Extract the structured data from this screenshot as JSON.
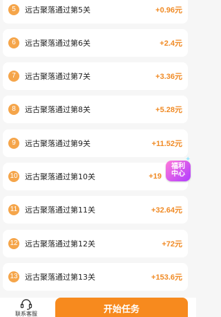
{
  "levels": [
    {
      "num": "5",
      "label": "远古聚落通过第5关",
      "reward": "+0.96元"
    },
    {
      "num": "6",
      "label": "远古聚落通过第6关",
      "reward": "+2.4元"
    },
    {
      "num": "7",
      "label": "远古聚落通过第7关",
      "reward": "+3.36元"
    },
    {
      "num": "8",
      "label": "远古聚落通过第8关",
      "reward": "+5.28元"
    },
    {
      "num": "9",
      "label": "远古聚落通过第9关",
      "reward": "+11.52元"
    },
    {
      "num": "10",
      "label": "远古聚落通过第10关",
      "reward": "+19"
    },
    {
      "num": "11",
      "label": "远古聚落通过第11关",
      "reward": "+32.64元"
    },
    {
      "num": "12",
      "label": "远古聚落通过第12关",
      "reward": "+72元"
    },
    {
      "num": "13",
      "label": "远古聚落通过第13关",
      "reward": "+153.6元"
    }
  ],
  "welfare": {
    "line1": "福利",
    "line2": "中心"
  },
  "bottom": {
    "contact_label": "联系客服",
    "start_label": "开始任务"
  },
  "colors": {
    "accent": "#f08a24",
    "badge": "#f5a54a",
    "button": "#f78a1e",
    "welfare_gradient_start": "#ff7ad9",
    "welfare_gradient_end": "#b03cff"
  },
  "icons": {
    "contact": "headset-icon",
    "welfare": "gift-badge-icon"
  }
}
